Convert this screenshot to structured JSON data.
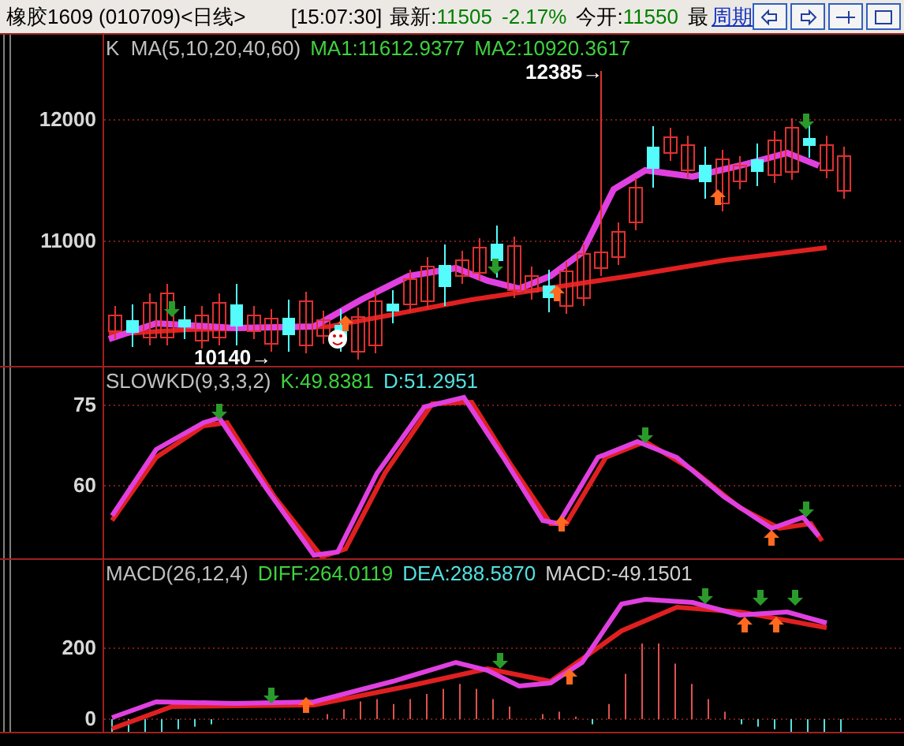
{
  "header": {
    "title": "橡胶1609 (010709)<日线>",
    "time": "[15:07:30]",
    "latest_label": "最新:",
    "latest_value": "11505",
    "change": "-2.17%",
    "open_label": "今开:",
    "open_value": "11550",
    "cut_label": "最",
    "period_link": "周期"
  },
  "panels": [
    {
      "kind": "price",
      "legend": [
        {
          "text": "K  MA(5,10,20,40,60)",
          "color": "#c0c0c0"
        },
        {
          "text": "MA1:11612.9377",
          "color": "#3fd23f"
        },
        {
          "text": "MA2:10920.3617",
          "color": "#3fd23f"
        }
      ],
      "axis_labels": [
        "12000",
        "11000"
      ],
      "annotations": [
        "12385→",
        "10140→"
      ]
    },
    {
      "kind": "kd",
      "legend": [
        {
          "text": "SLOWKD(9,3,3,2)",
          "color": "#c0c0c0"
        },
        {
          "text": "K:49.8381",
          "color": "#3fd23f"
        },
        {
          "text": "D:51.2951",
          "color": "#54e0e0"
        }
      ],
      "axis_labels": [
        "75",
        "60"
      ]
    },
    {
      "kind": "macd",
      "legend": [
        {
          "text": "MACD(26,12,4)",
          "color": "#c0c0c0"
        },
        {
          "text": "DIFF:264.0119",
          "color": "#3fd23f"
        },
        {
          "text": "DEA:288.5870",
          "color": "#54e0e0"
        },
        {
          "text": "MACD:-49.1501",
          "color": "#d0d0d0"
        }
      ],
      "axis_labels": [
        "200",
        "0"
      ]
    }
  ]
}
